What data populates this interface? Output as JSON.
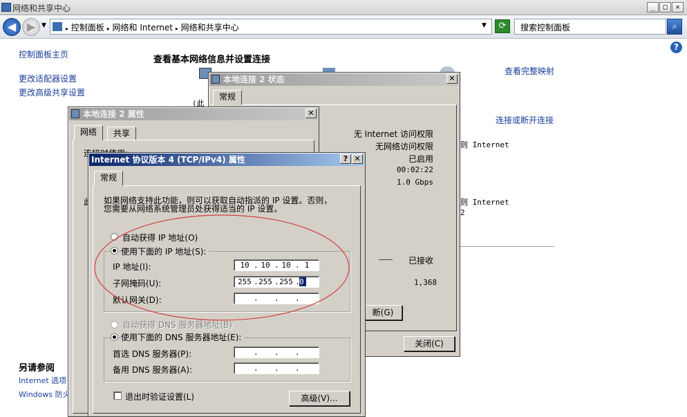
{
  "window": {
    "title": "网络和共享中心",
    "min": "_",
    "max": "□",
    "close": "✕"
  },
  "address": {
    "crumbs": [
      "控制面板",
      "网络和 Internet",
      "网络和共享中心"
    ],
    "search_placeholder": "搜索控制面板"
  },
  "sidebar": {
    "items": [
      "控制面板主页",
      "更改适配器设置",
      "更改高级共享设置"
    ],
    "see_also_title": "另请参阅",
    "see_also": [
      "Internet 选项",
      "Windows 防火墙"
    ]
  },
  "main": {
    "heading": "查看基本网络信息并设置连接",
    "view_full_map": "查看完整映射",
    "connect_disconnect": "连接或断开连接",
    "access_internet_1": "Internet",
    "access_internet_2": "Internet",
    "partial_text_1": "(此",
    "partial_text_2": "2"
  },
  "status_dialog": {
    "title": "本地连接 2 状态",
    "tab": "常规",
    "ipv4": "无 Internet 访问权限",
    "ipv6": "无网络访问权限",
    "media": "已启用",
    "duration": "00:02:22",
    "speed": "1.0 Gbps",
    "received_label": "已接收",
    "received_value": "1,368",
    "disable_button": "断(G)",
    "close_button": "关闭(C)"
  },
  "props_dialog": {
    "title": "本地连接 2 属性",
    "tabs": [
      "网络",
      "共享"
    ],
    "connect_using": "连接时使用:",
    "partial": "此"
  },
  "ipv4_dialog": {
    "title": "Internet 协议版本 4 (TCP/IPv4) 属性",
    "help": "?",
    "close": "✕",
    "tab": "常规",
    "description_1": "如果网络支持此功能，则可以获取自动指派的 IP 设置。否则，",
    "description_2": "您需要从网络系统管理员处获得适当的 IP 设置。",
    "auto_ip": "自动获得 IP 地址(O)",
    "use_ip": "使用下面的 IP 地址(S):",
    "ip_label": "IP 地址(I):",
    "ip_value": [
      "10",
      "10",
      "10",
      "1"
    ],
    "mask_label": "子网掩码(U):",
    "mask_value": [
      "255",
      "255",
      "255",
      "0"
    ],
    "gateway_label": "默认网关(D):",
    "auto_dns": "自动获得 DNS 服务器地址(B)",
    "use_dns": "使用下面的 DNS 服务器地址(E):",
    "dns1_label": "首选 DNS 服务器(P):",
    "dns2_label": "备用 DNS 服务器(A):",
    "validate": "退出时验证设置(L)",
    "advanced": "高级(V)..."
  },
  "colors": {
    "link": "#1a3e9a",
    "annotation": "#d04040",
    "dialog_bg": "#d4d0c8",
    "caption_active": "#0a246a"
  }
}
